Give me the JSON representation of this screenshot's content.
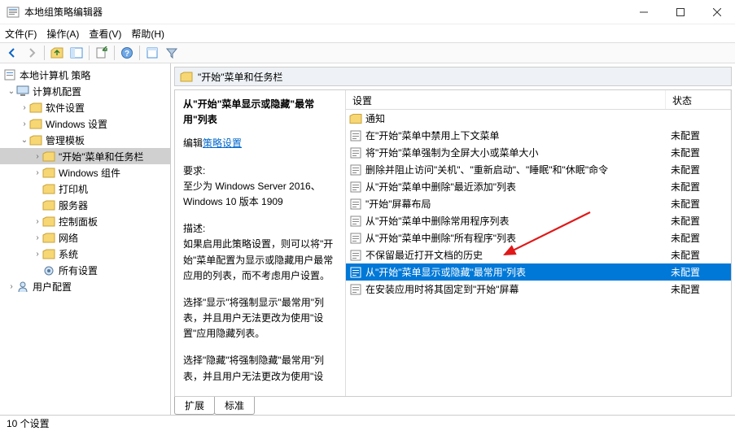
{
  "window": {
    "title": "本地组策略编辑器"
  },
  "menubar": {
    "file": "文件(F)",
    "action": "操作(A)",
    "view": "查看(V)",
    "help": "帮助(H)"
  },
  "tree": {
    "root": "本地计算机 策略",
    "computer_config": "计算机配置",
    "software_settings": "软件设置",
    "windows_settings": "Windows 设置",
    "admin_templates": "管理模板",
    "start_taskbar": "\"开始\"菜单和任务栏",
    "windows_components": "Windows 组件",
    "printers": "打印机",
    "server": "服务器",
    "control_panel": "控制面板",
    "network": "网络",
    "system": "系统",
    "all_settings": "所有设置",
    "user_config": "用户配置"
  },
  "path_header": "\"开始\"菜单和任务栏",
  "description": {
    "title": "从\"开始\"菜单显示或隐藏\"最常用\"列表",
    "edit_link_prefix": "编辑",
    "edit_link": "策略设置",
    "req_label": "要求:",
    "req_text": "至少为 Windows Server 2016、Windows 10 版本 1909",
    "desc_label": "描述:",
    "desc_p1": "如果启用此策略设置，则可以将\"开始\"菜单配置为显示或隐藏用户最常应用的列表，而不考虑用户设置。",
    "desc_p2": "选择\"显示\"将强制显示\"最常用\"列表，并且用户无法更改为使用\"设置\"应用隐藏列表。",
    "desc_p3": "选择\"隐藏\"将强制隐藏\"最常用\"列表，并且用户无法更改为使用\"设"
  },
  "list": {
    "header_setting": "设置",
    "header_state": "状态",
    "folder_notifications": "通知",
    "rows": [
      {
        "name": "在\"开始\"菜单中禁用上下文菜单",
        "state": "未配置"
      },
      {
        "name": "将\"开始\"菜单强制为全屏大小或菜单大小",
        "state": "未配置"
      },
      {
        "name": "删除并阻止访问\"关机\"、\"重新启动\"、\"睡眠\"和\"休眠\"命令",
        "state": "未配置"
      },
      {
        "name": "从\"开始\"菜单中删除\"最近添加\"列表",
        "state": "未配置"
      },
      {
        "name": "\"开始\"屏幕布局",
        "state": "未配置"
      },
      {
        "name": "从\"开始\"菜单中删除常用程序列表",
        "state": "未配置"
      },
      {
        "name": "从\"开始\"菜单中删除\"所有程序\"列表",
        "state": "未配置"
      },
      {
        "name": "不保留最近打开文档的历史",
        "state": "未配置"
      },
      {
        "name": "从\"开始\"菜单显示或隐藏\"最常用\"列表",
        "state": "未配置",
        "selected": true
      },
      {
        "name": "在安装应用时将其固定到\"开始\"屏幕",
        "state": "未配置"
      }
    ]
  },
  "tabs": {
    "extended": "扩展",
    "standard": "标准"
  },
  "statusbar": "10 个设置"
}
